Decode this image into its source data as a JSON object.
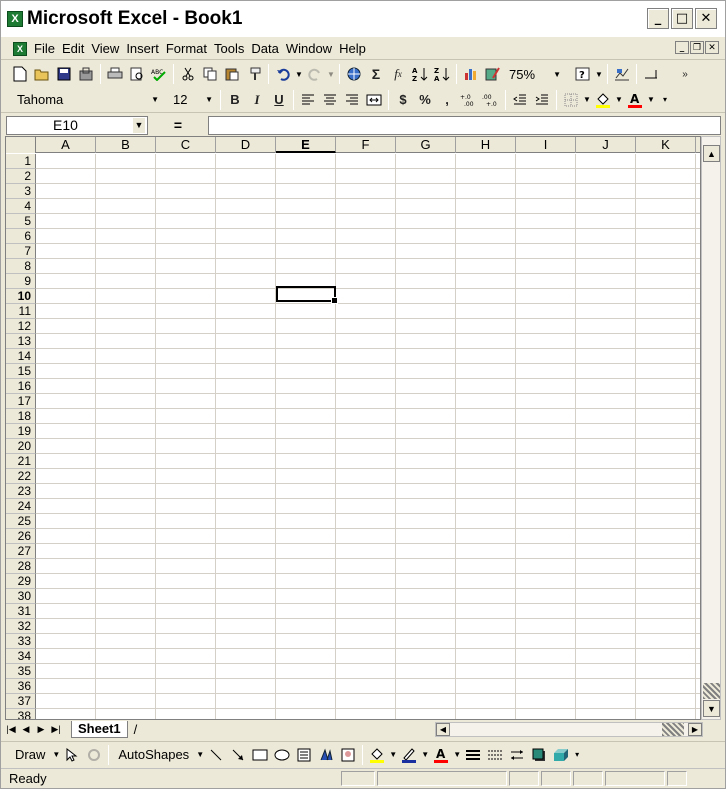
{
  "window": {
    "title": "Microsoft Excel - Book1",
    "app_icon": "X",
    "buttons": {
      "minimize": "_",
      "maximize": "□",
      "close": "✕"
    }
  },
  "menu": {
    "items": [
      "File",
      "Edit",
      "View",
      "Insert",
      "Format",
      "Tools",
      "Data",
      "Window",
      "Help"
    ],
    "mdi_buttons": {
      "minimize": "_",
      "restore": "❐",
      "close": "✕"
    }
  },
  "standard_toolbar": {
    "zoom": "75%",
    "icons": [
      "new-icon",
      "open-icon",
      "save-icon",
      "permission-icon",
      "print-icon",
      "print-preview-icon",
      "spelling-icon",
      "cut-icon",
      "copy-icon",
      "paste-icon",
      "format-painter-icon",
      "undo-icon",
      "redo-icon",
      "hyperlink-icon",
      "autosum-icon",
      "function-icon",
      "sort-ascending-icon",
      "sort-descending-icon",
      "chart-wizard-icon",
      "drawing-icon",
      "help-icon",
      "chart-type-icon"
    ]
  },
  "formatting_toolbar": {
    "font": "Tahoma",
    "size": "12",
    "bold": "B",
    "italic": "I",
    "underline": "U",
    "currency": "$",
    "percent": "%",
    "comma": ","
  },
  "formula_bar": {
    "name_box": "E10",
    "equals": "=",
    "value": ""
  },
  "grid": {
    "columns": [
      "A",
      "B",
      "C",
      "D",
      "E",
      "F",
      "G",
      "H",
      "I",
      "J",
      "K"
    ],
    "rows": [
      "1",
      "2",
      "3",
      "4",
      "5",
      "6",
      "7",
      "8",
      "9",
      "10",
      "11",
      "12",
      "13",
      "14",
      "15",
      "16",
      "17",
      "18",
      "19",
      "20",
      "21",
      "22",
      "23",
      "24",
      "25",
      "26",
      "27",
      "28",
      "29",
      "30",
      "31",
      "32",
      "33",
      "34",
      "35",
      "36",
      "37",
      "38"
    ],
    "active_column": "E",
    "active_row": "10"
  },
  "sheet_tabs": {
    "tabs": [
      "Sheet1"
    ]
  },
  "draw_toolbar": {
    "draw_label": "Draw",
    "autoshapes_label": "AutoShapes"
  },
  "status": {
    "text": "Ready"
  }
}
